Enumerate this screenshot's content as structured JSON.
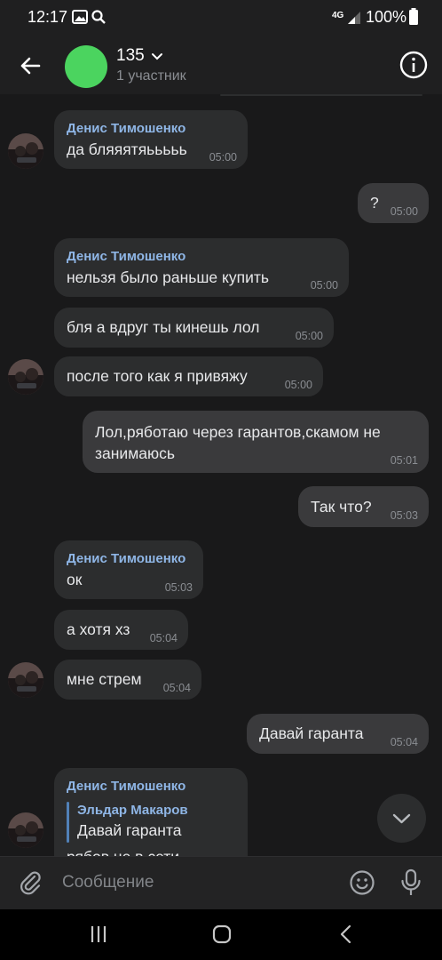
{
  "status_bar": {
    "time": "12:17",
    "network": "4G",
    "battery": "100%"
  },
  "header": {
    "title": "135",
    "subtitle": "1 участник",
    "avatar_color": "#4bd45f"
  },
  "messages": [
    {
      "sender": "Денис Тимошенко",
      "text": "да бляяятяььььь",
      "time": "05:00",
      "direction": "in"
    },
    {
      "text": "?",
      "time": "05:00",
      "direction": "out"
    },
    {
      "sender": "Денис Тимошенко",
      "text": "нельзя было раньше купить",
      "time": "05:00",
      "direction": "in"
    },
    {
      "text": "бля а вдруг ты кинешь лол",
      "time": "05:00",
      "direction": "in"
    },
    {
      "text": "после того как я привяжу",
      "time": "05:00",
      "direction": "in"
    },
    {
      "lines": [
        "Лол,ряботаю через гарантов,скамом не",
        "занимаюсь"
      ],
      "time": "05:01",
      "direction": "out"
    },
    {
      "text": "Так что?",
      "time": "05:03",
      "direction": "out"
    },
    {
      "sender": "Денис Тимошенко",
      "text": "ок",
      "time": "05:03",
      "direction": "in"
    },
    {
      "text": "а хотя хз",
      "time": "05:04",
      "direction": "in"
    },
    {
      "text": "мне стрем",
      "time": "05:04",
      "direction": "in"
    },
    {
      "text": "Давай гаранта",
      "time": "05:04",
      "direction": "out"
    },
    {
      "sender": "Денис Тимошенко",
      "reply": {
        "name": "Эльдар Макаров",
        "text": "Давай гаранта"
      },
      "text": "рябов не в сети",
      "direction": "in"
    }
  ],
  "composer": {
    "placeholder": "Сообщение"
  },
  "icons": {
    "back": "arrow-left-icon",
    "info": "info-icon",
    "chevron": "chevron-down-icon",
    "attach": "paperclip-icon",
    "emoji": "smiley-icon",
    "mic": "microphone-icon",
    "scroll": "chevron-down-icon",
    "nav_recents": "recents-icon",
    "nav_home": "home-icon",
    "nav_back": "back-icon"
  },
  "colors": {
    "background": "#19191a",
    "bubble_in": "#2c2d2e",
    "bubble_out": "#3a3a3c",
    "sender_name": "#8fb6e6",
    "accent": "#5181b8"
  }
}
